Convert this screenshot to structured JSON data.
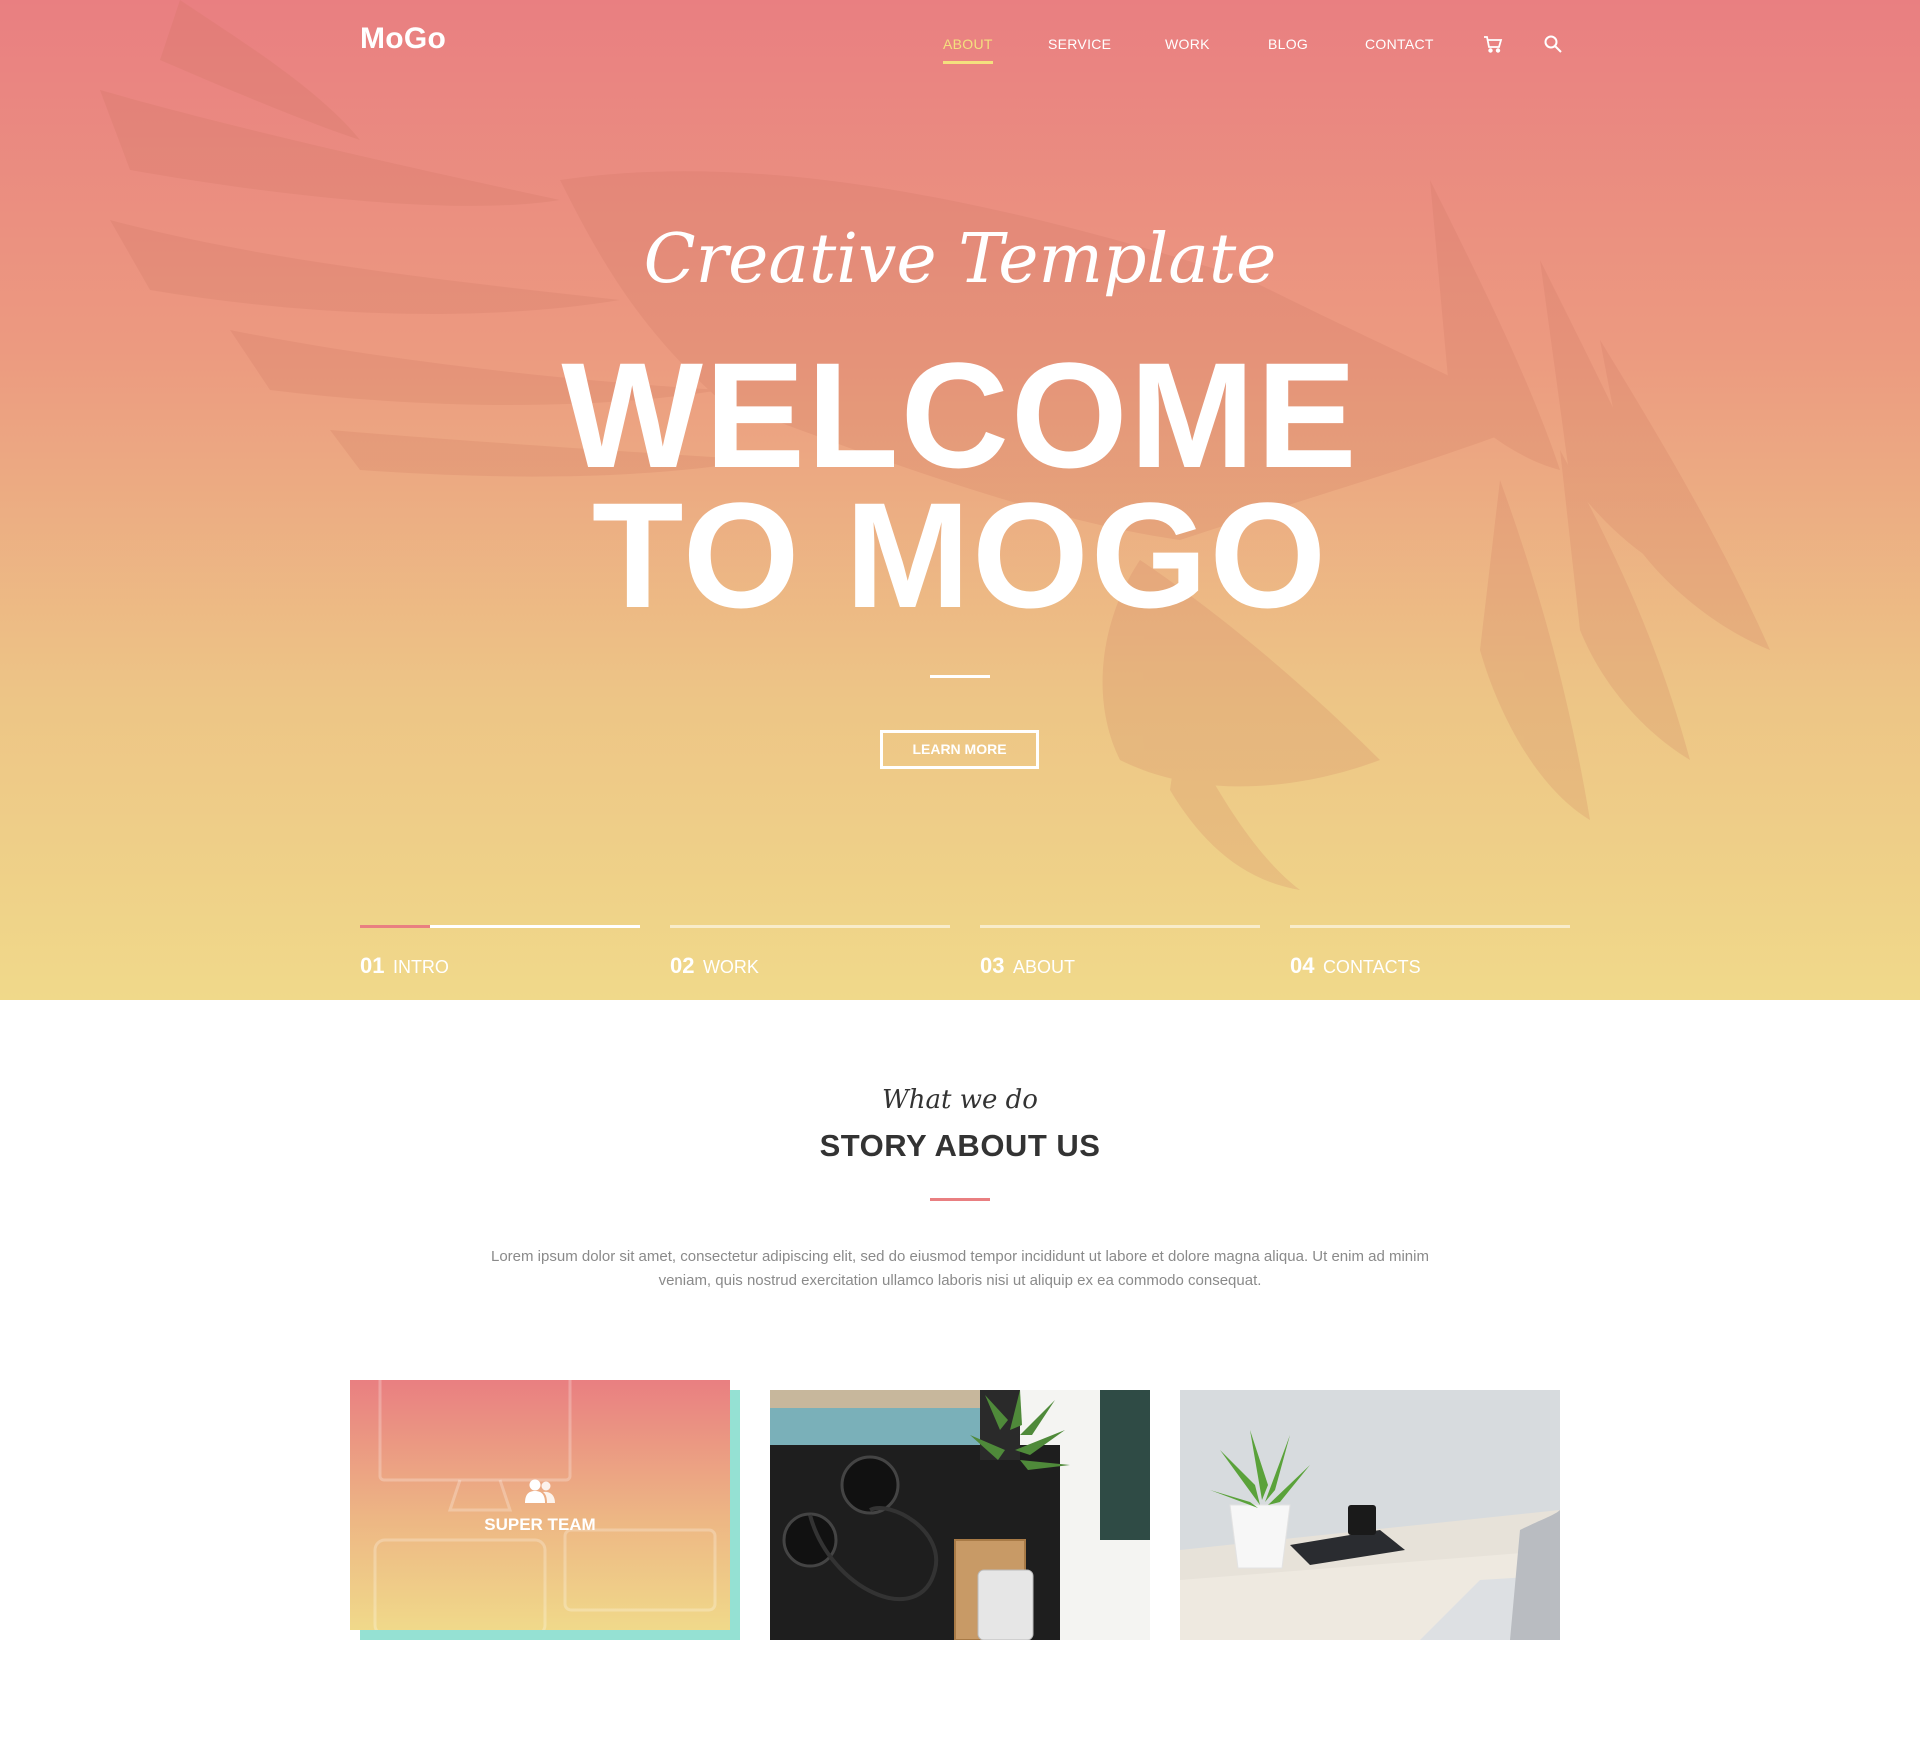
{
  "brand": {
    "name": "MoGo"
  },
  "nav": {
    "items": [
      {
        "label": "About",
        "active": true
      },
      {
        "label": "Service"
      },
      {
        "label": "Work"
      },
      {
        "label": "Blog"
      },
      {
        "label": "Contact"
      }
    ],
    "icons": [
      "cart-icon",
      "search-icon"
    ]
  },
  "hero": {
    "script": "Creative Template",
    "title_line1": "WELCOME",
    "title_line2": "TO MOGO",
    "cta_label": "LEARN MORE"
  },
  "steps": [
    {
      "num": "01",
      "label": "Intro",
      "progress": 0.25
    },
    {
      "num": "02",
      "label": "Work"
    },
    {
      "num": "03",
      "label": "About"
    },
    {
      "num": "04",
      "label": "Contacts"
    }
  ],
  "story": {
    "kicker": "What we do",
    "title": "STORY ABOUT US",
    "text": "Lorem ipsum dolor sit amet, consectetur adipiscing elit, sed do eiusmod tempor incididunt ut labore et dolore magna aliqua. Ut enim ad minim veniam, quis nostrud exercitation ullamco laboris nisi ut aliquip ex ea commodo consequat."
  },
  "cards": [
    {
      "label": "SUPER TEAM",
      "icon": "team-icon"
    },
    {
      "photo": "desk-headphones-photo"
    },
    {
      "photo": "desk-plant-photo"
    }
  ],
  "colors": {
    "accent": "#e97f81",
    "active_nav": "#f4e07e",
    "card_shadow": "#95e1d3",
    "heading": "#333333"
  }
}
